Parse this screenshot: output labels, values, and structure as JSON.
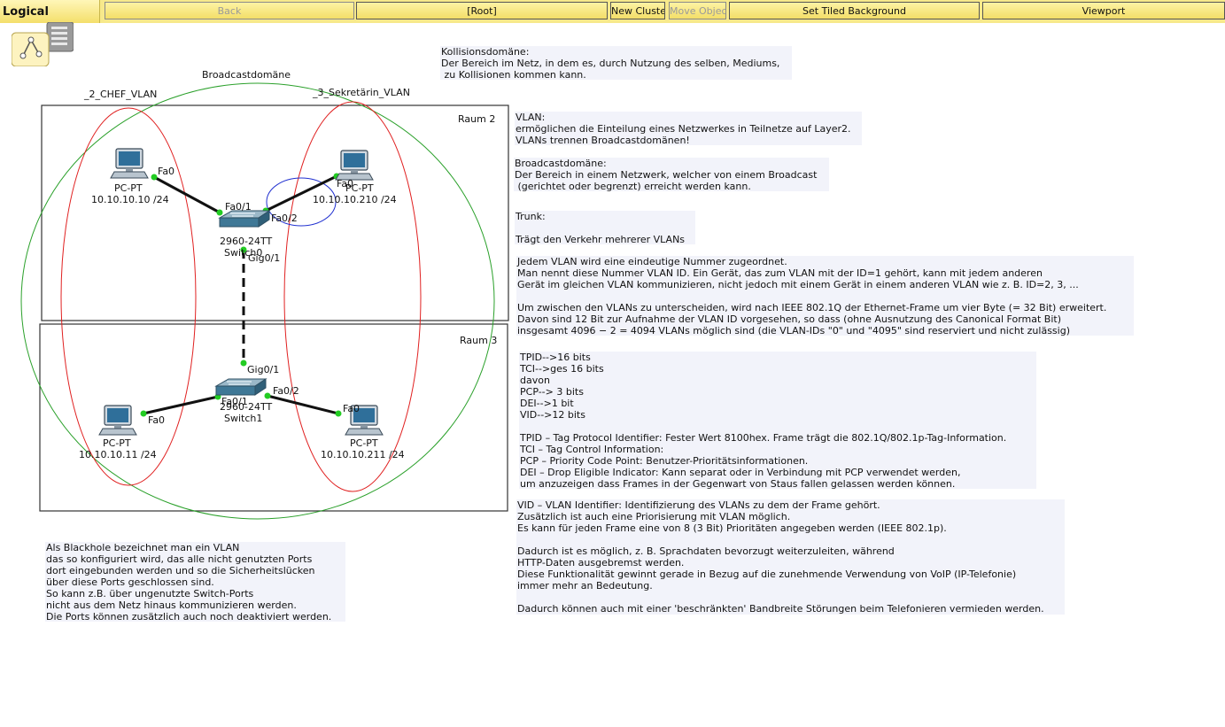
{
  "toolbar": {
    "tab_label": "Logical",
    "back_label": "Back",
    "root_label": "[Root]",
    "new_cluster_label": "New Cluster",
    "move_object_label": "Move Object",
    "set_tiled_bg_label": "Set Tiled Background",
    "viewport_label": "Viewport"
  },
  "topology": {
    "broadcast_label": "Broadcastdomäne",
    "vlan2_label": "_2_CHEF_VLAN",
    "vlan3_label": "_3_Sekretärin_VLAN",
    "room2_label": "Raum 2",
    "room3_label": "Raum 3",
    "switch0": {
      "model": "2960-24TT",
      "name": "Switch0"
    },
    "switch1": {
      "model": "2960-24TT",
      "name": "Switch1"
    },
    "pc_tl": {
      "type": "PC-PT",
      "ip": "10.10.10.10 /24"
    },
    "pc_tr": {
      "type": "PC-PT",
      "ip": "10.10.10.210 /24"
    },
    "pc_bl": {
      "type": "PC-PT",
      "ip": "10.10.10.11 /24"
    },
    "pc_br": {
      "type": "PC-PT",
      "ip": "10.10.10.211 /24"
    },
    "ports": {
      "pc_tl_fa0": "Fa0",
      "pc_tr_fa0": "Fa0",
      "sw0_fa01": "Fa0/1",
      "sw0_fa02": "Fa0/2",
      "sw0_gig01": "Gig0/1",
      "sw1_gig01": "Gig0/1",
      "sw1_fa01": "Fa0/1",
      "sw1_fa02": "Fa0/2",
      "pc_bl_fa0": "Fa0",
      "pc_br_fa0": "Fa0"
    }
  },
  "notes": {
    "kollision": "Kollisionsdomäne:\nDer Bereich im Netz, in dem es, durch Nutzung des selben, Mediums,\n zu Kollisionen kommen kann.",
    "vlan": "VLAN:\nermöglichen die Einteilung eines Netzwerkes in Teilnetze auf Layer2.\nVLANs trennen Broadcastdomänen!",
    "broadcast": "Broadcastdomäne:\nDer Bereich in einem Netzwerk, welcher von einem Broadcast\n (gerichtet oder begrenzt) erreicht werden kann.",
    "trunk": "Trunk:\n\nTrägt den Verkehr mehrerer VLANs",
    "vlan_id": "Jedem VLAN wird eine eindeutige Nummer zugeordnet.\nMan nennt diese Nummer VLAN ID. Ein Gerät, das zum VLAN mit der ID=1 gehört, kann mit jedem anderen\nGerät im gleichen VLAN kommunizieren, nicht jedoch mit einem Gerät in einem anderen VLAN wie z. B. ID=2, 3, ...\n\nUm zwischen den VLANs zu unterscheiden, wird nach IEEE 802.1Q der Ethernet-Frame um vier Byte (= 32 Bit) erweitert.\nDavon sind 12 Bit zur Aufnahme der VLAN ID vorgesehen, so dass (ohne Ausnutzung des Canonical Format Bit)\ninsgesamt 4096 − 2 = 4094 VLANs möglich sind (die VLAN-IDs \"0\" und \"4095\" sind reserviert und nicht zulässig)",
    "tpid": "TPID-->16 bits\nTCI-->ges 16 bits\ndavon\nPCP--> 3 bits\nDEI-->1 bit\nVID-->12 bits\n\nTPID – Tag Protocol Identifier: Fester Wert 8100hex. Frame trägt die 802.1Q/802.1p-Tag-Information.\nTCI – Tag Control Information:\nPCP – Priority Code Point: Benutzer-Prioritätsinformationen.\nDEI – Drop Eligible Indicator: Kann separat oder in Verbindung mit PCP verwendet werden,\num anzuzeigen dass Frames in der Gegenwart von Staus fallen gelassen werden können.",
    "vid": "VID – VLAN Identifier: Identifizierung des VLANs zu dem der Frame gehört.\nZusätzlich ist auch eine Priorisierung mit VLAN möglich.\nEs kann für jeden Frame eine von 8 (3 Bit) Prioritäten angegeben werden (IEEE 802.1p).\n\nDadurch ist es möglich, z. B. Sprachdaten bevorzugt weiterzuleiten, während\nHTTP-Daten ausgebremst werden.\nDiese Funktionalität gewinnt gerade in Bezug auf die zunehmende Verwendung von VoIP (IP-Telefonie)\nimmer mehr an Bedeutung.\n\nDadurch können auch mit einer 'beschränkten' Bandbreite Störungen beim Telefonieren vermieden werden.",
    "blackhole": "Als Blackhole bezeichnet man ein VLAN\ndas so konfiguriert wird, das alle nicht genutzten Ports\ndort eingebunden werden und so die Sicherheitslücken\nüber diese Ports geschlossen sind.\nSo kann z.B. über ungenutzte Switch-Ports\nnicht aus dem Netz hinaus kommunizieren werden.\nDie Ports können zusätzlich auch noch deaktiviert werden."
  },
  "colors": {
    "toolbar_bg": "#f7e98b",
    "vlan_ellipse": "#e02020",
    "broadcast_circle": "#2aa02a",
    "collision_ellipse": "#2030d0",
    "link_up_dot": "#22cc22",
    "note_bg": "#f2f3fa"
  },
  "icons": [
    "logical-nav-icon",
    "pc-icon",
    "switch-icon"
  ]
}
